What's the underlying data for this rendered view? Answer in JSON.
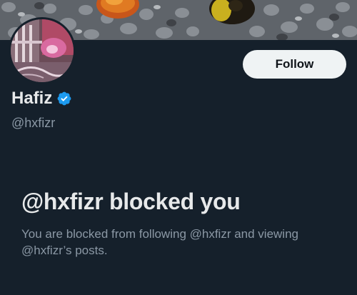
{
  "profile": {
    "display_name": "Hafiz",
    "handle": "@hxfizr",
    "verified": true,
    "accent_color": "#1d9bf0"
  },
  "actions": {
    "follow_label": "Follow"
  },
  "blocked": {
    "title": "@hxfizr blocked you",
    "description": "You are blocked from following @hxfizr and viewing @hxfizr’s posts."
  },
  "icons": {
    "verified": "verified-badge-icon"
  },
  "theme": {
    "background": "#15202b",
    "primary_text": "#e7e9ea",
    "secondary_text": "#8b98a5"
  }
}
